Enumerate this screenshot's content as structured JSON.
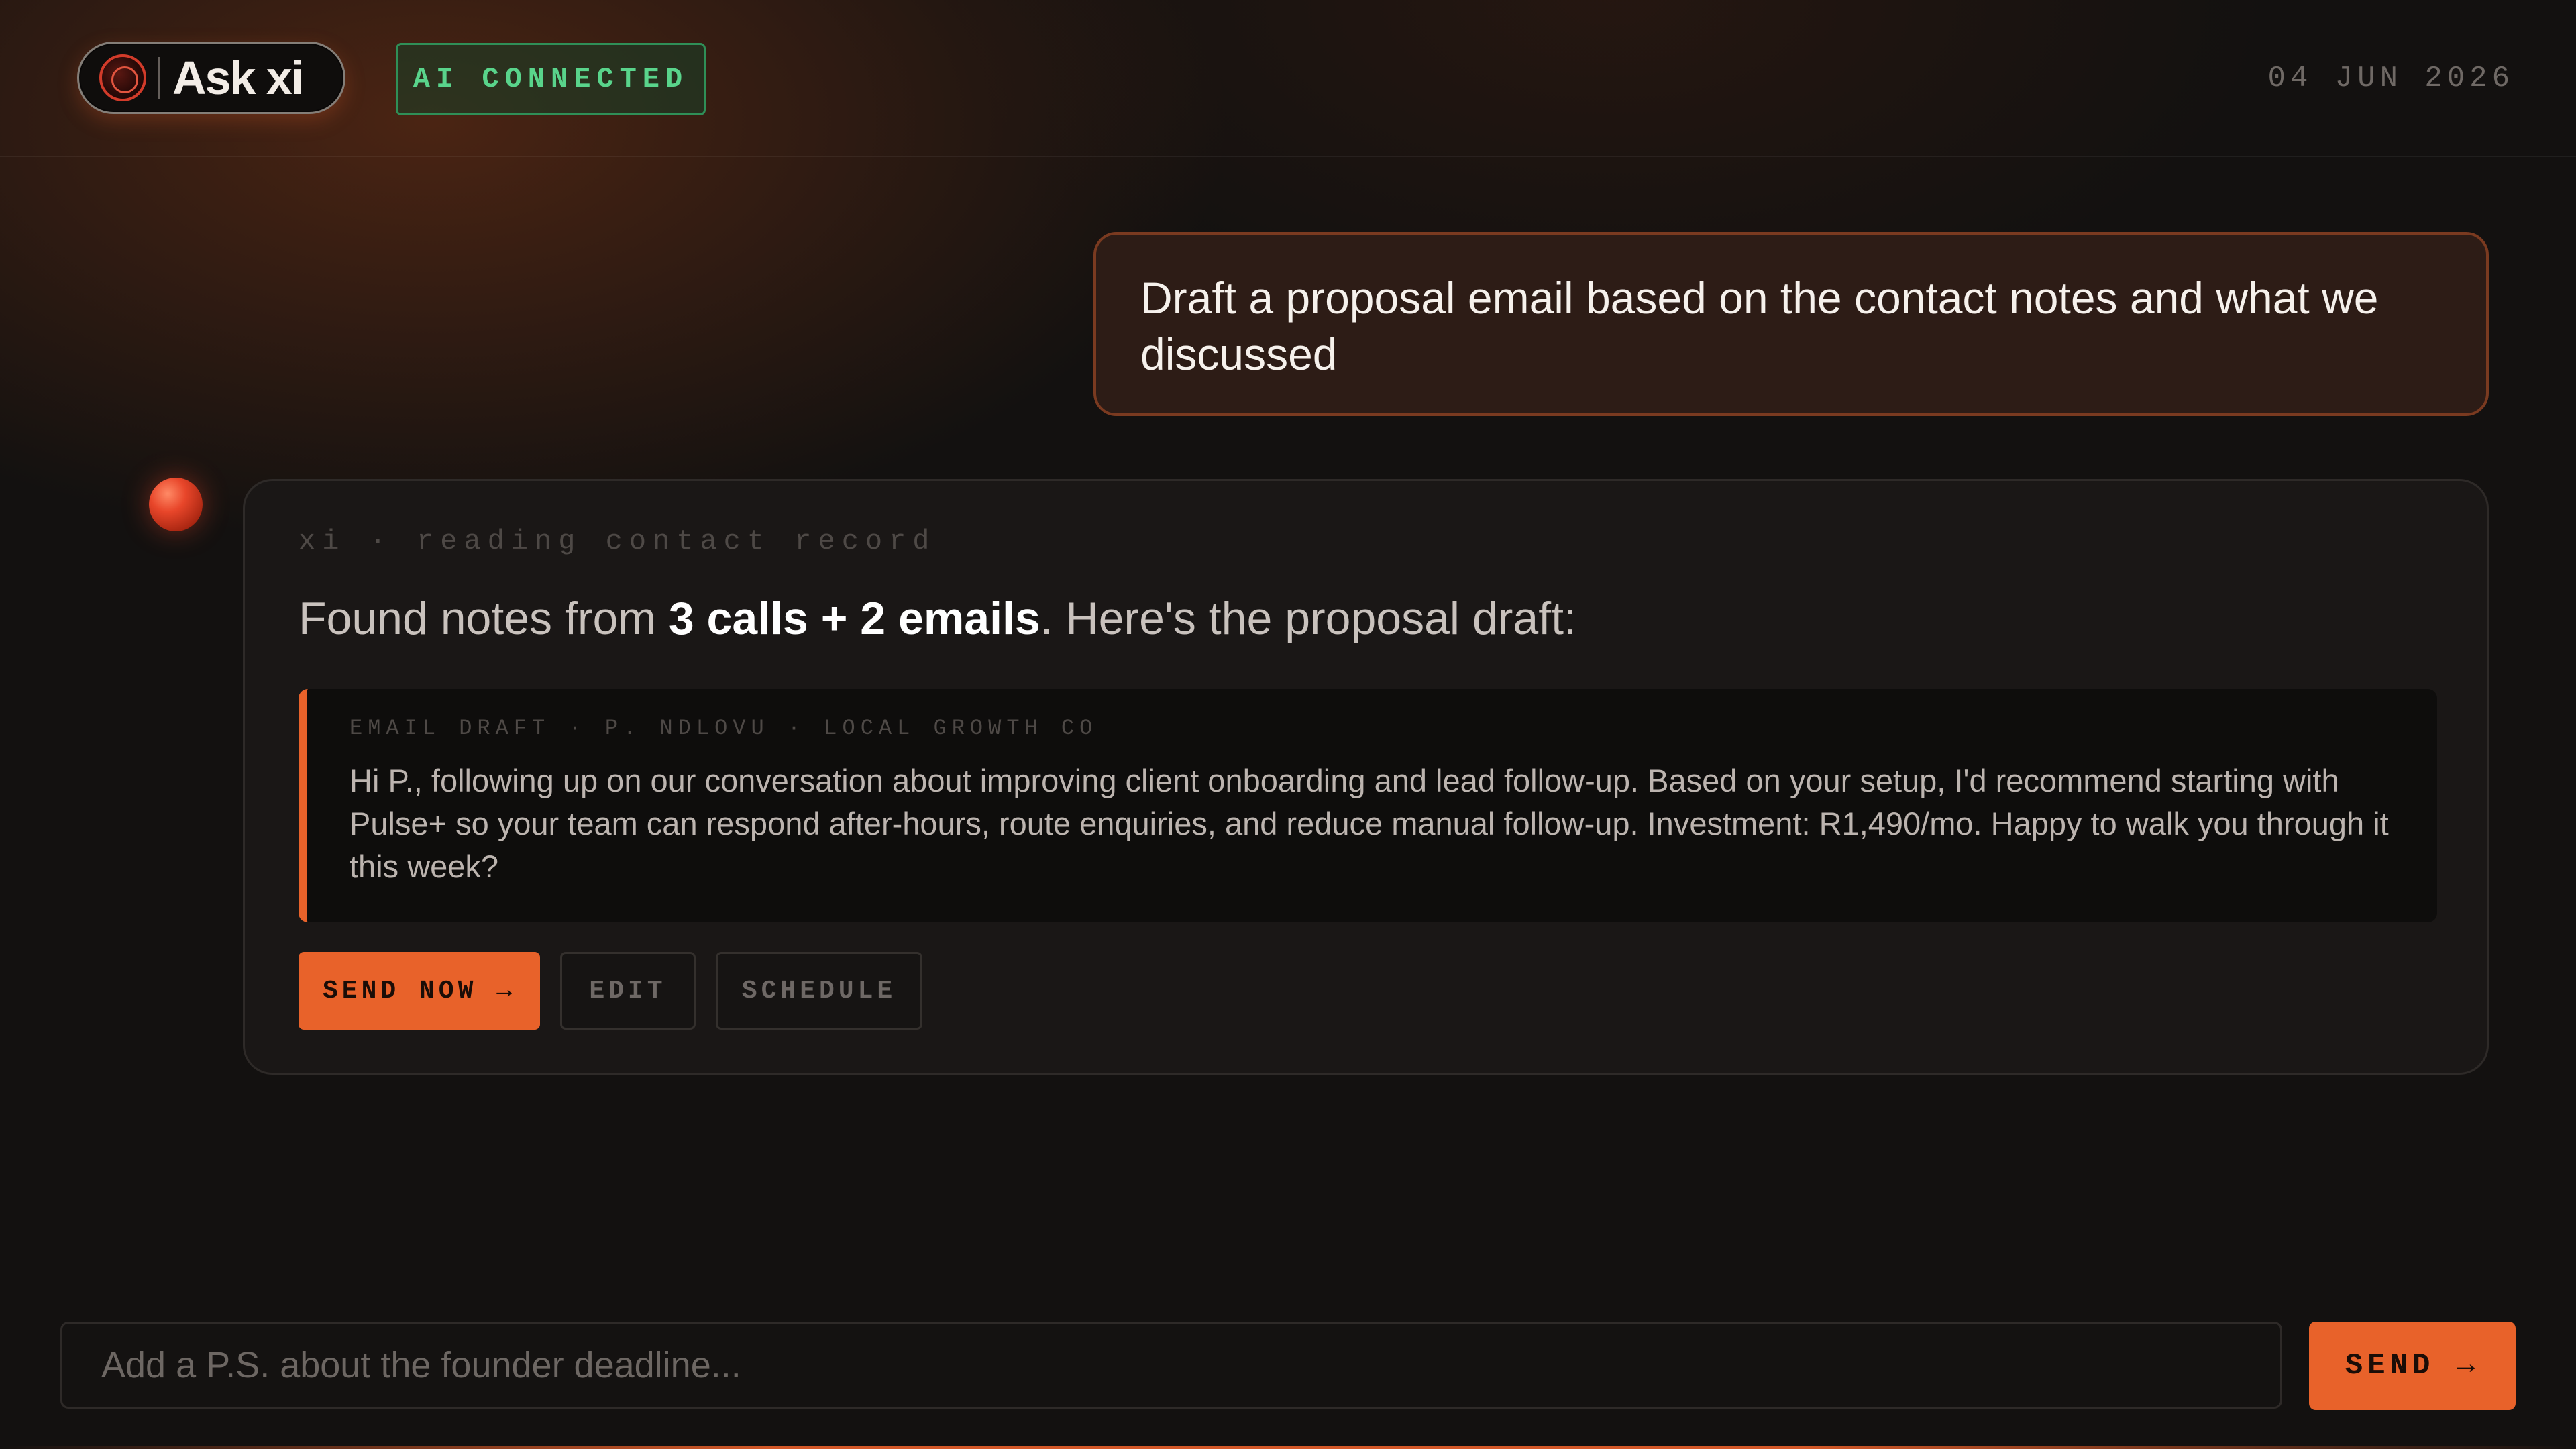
{
  "header": {
    "app_name": "Ask xi",
    "logo_icon": "orb-logo-icon",
    "status_badge": "AI CONNECTED",
    "date": "04 JUN 2026"
  },
  "conversation": {
    "user_message": "Draft a proposal email based on the contact notes and what we discussed",
    "ai": {
      "avatar_icon": "ai-orb-icon",
      "meta": "xi · reading contact record",
      "intro_before": "Found notes from ",
      "intro_highlight": "3 calls + 2 emails",
      "intro_after": ". Here's the proposal draft:",
      "draft": {
        "label": "EMAIL DRAFT · P. NDLOVU · LOCAL GROWTH CO",
        "body": "Hi P., following up on our conversation about improving client onboarding and lead follow-up. Based on your setup, I'd recommend starting with Pulse+ so your team can respond after-hours, route enquiries, and reduce manual follow-up. Investment: R1,490/mo. Happy to walk you through it this week?"
      },
      "actions": {
        "send_now": "SEND NOW →",
        "edit": "EDIT",
        "schedule": "SCHEDULE"
      }
    }
  },
  "composer": {
    "placeholder": "Add a P.S. about the founder deadline...",
    "value": "",
    "send_label": "SEND →"
  },
  "colors": {
    "accent": "#e8622a",
    "status_green": "#59d48b",
    "background": "#131110",
    "user_bubble": "#2d1c16",
    "card": "#1a1716"
  }
}
